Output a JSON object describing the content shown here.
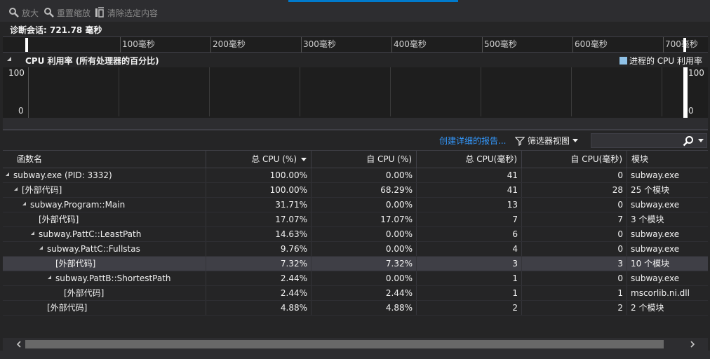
{
  "toolbar": {
    "zoom_in": "放大",
    "reset_zoom": "重置缩放",
    "clear_selection": "清除选定内容"
  },
  "session": {
    "label": "诊断会话: 721.78 毫秒"
  },
  "ruler": {
    "ticks": [
      "100毫秒",
      "200毫秒",
      "300毫秒",
      "400毫秒",
      "500毫秒",
      "600毫秒",
      "700毫秒"
    ]
  },
  "cpu": {
    "title": "CPU 利用率 (所有处理器的百分比)",
    "legend": "进程的 CPU 利用率",
    "y_max": "100",
    "y_min": "0",
    "legend_color": "#8fc1e6"
  },
  "details": {
    "create_report": "创建详细的报告...",
    "filter_view": "筛选器视图",
    "search_value": ""
  },
  "table": {
    "headers": {
      "name": "函数名",
      "total_cpu_pct": "总 CPU (%)",
      "self_cpu_pct": "自 CPU (%)",
      "total_cpu_ms": "总 CPU(毫秒)",
      "self_cpu_ms": "自 CPU(毫秒)",
      "module": "模块"
    },
    "rows": [
      {
        "name": "subway.exe (PID: 3332)",
        "total_pct": "100.00%",
        "self_pct": "0.00%",
        "total_ms": "41",
        "self_ms": "0",
        "module": "subway.exe"
      },
      {
        "name": "[外部代码]",
        "total_pct": "100.00%",
        "self_pct": "68.29%",
        "total_ms": "41",
        "self_ms": "28",
        "module": "25 个模块"
      },
      {
        "name": "subway.Program::Main",
        "total_pct": "31.71%",
        "self_pct": "0.00%",
        "total_ms": "13",
        "self_ms": "0",
        "module": "subway.exe"
      },
      {
        "name": "[外部代码]",
        "total_pct": "17.07%",
        "self_pct": "17.07%",
        "total_ms": "7",
        "self_ms": "7",
        "module": "3 个模块"
      },
      {
        "name": "subway.PattC::LeastPath",
        "total_pct": "14.63%",
        "self_pct": "0.00%",
        "total_ms": "6",
        "self_ms": "0",
        "module": "subway.exe"
      },
      {
        "name": "subway.PattC::Fullstas",
        "total_pct": "9.76%",
        "self_pct": "0.00%",
        "total_ms": "4",
        "self_ms": "0",
        "module": "subway.exe"
      },
      {
        "name": "[外部代码]",
        "total_pct": "7.32%",
        "self_pct": "7.32%",
        "total_ms": "3",
        "self_ms": "3",
        "module": "10 个模块"
      },
      {
        "name": "subway.PattB::ShortestPath",
        "total_pct": "2.44%",
        "self_pct": "0.00%",
        "total_ms": "1",
        "self_ms": "0",
        "module": "subway.exe"
      },
      {
        "name": "[外部代码]",
        "total_pct": "2.44%",
        "self_pct": "2.44%",
        "total_ms": "1",
        "self_ms": "1",
        "module": "mscorlib.ni.dll"
      },
      {
        "name": "[外部代码]",
        "total_pct": "4.88%",
        "self_pct": "4.88%",
        "total_ms": "2",
        "self_ms": "2",
        "module": "2 个模块"
      }
    ]
  }
}
